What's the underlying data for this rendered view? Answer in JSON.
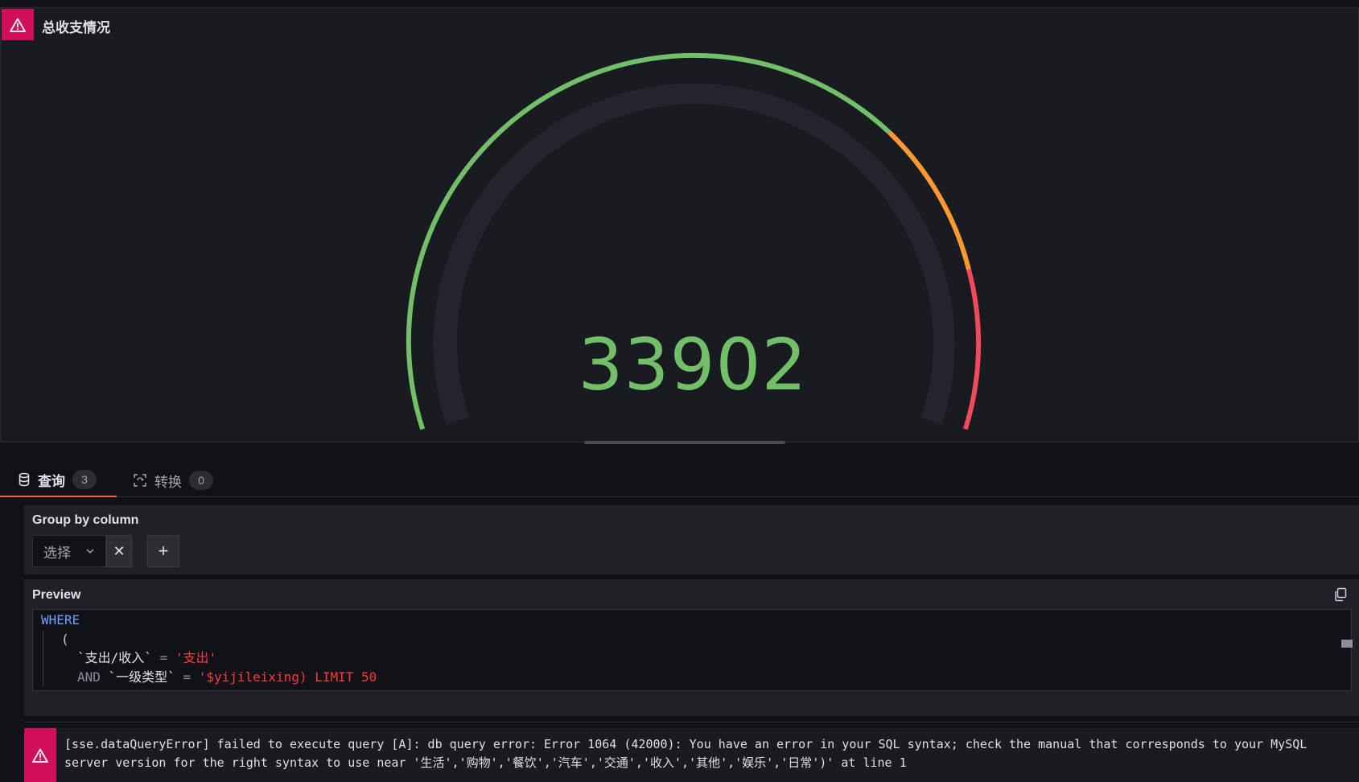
{
  "panel": {
    "title": "总收支情况",
    "gauge": {
      "value": 33902,
      "display_value": "33902",
      "value_color": "#73bf69",
      "threshold_colors": [
        "#73bf69",
        "#ff9830",
        "#f2495c"
      ]
    }
  },
  "tabs": [
    {
      "label": "查询",
      "count": "3",
      "icon": "database-icon",
      "active": true
    },
    {
      "label": "转换",
      "count": "0",
      "icon": "transform-icon",
      "active": false
    }
  ],
  "group_by": {
    "label": "Group by column",
    "select_placeholder": "选择",
    "clear_symbol": "✕",
    "add_symbol": "+"
  },
  "preview": {
    "label": "Preview",
    "code": {
      "line1_kw": "WHERE",
      "line2": "(",
      "line3_ident": "`支出/收入`",
      "line3_op": " = ",
      "line3_str": "'支出'",
      "line4_kw": "AND",
      "line4_ident": " `一级类型`",
      "line4_op": " = ",
      "line4_str": "'$yijileixing) LIMIT 50"
    }
  },
  "error": {
    "message": "[sse.dataQueryError] failed to execute query [A]: db query error: Error 1064 (42000): You have an error in your SQL syntax; check the manual that corresponds to your MySQL server version for the right syntax to use near '生活','购物','餐饮','汽车','交通','收入','其他','娱乐','日常')' at line 1"
  }
}
